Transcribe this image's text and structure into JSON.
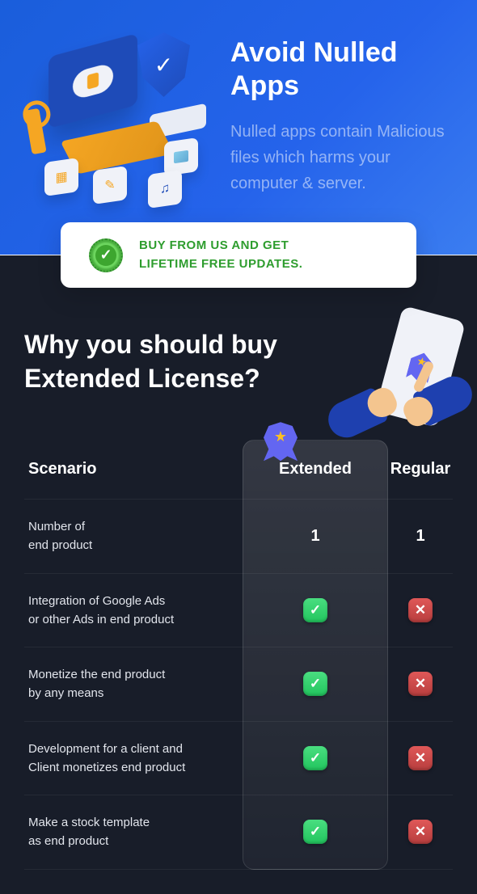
{
  "hero": {
    "title": "Avoid Nulled Apps",
    "description": "Nulled apps contain Malicious files which harms your computer & server."
  },
  "cta": {
    "line1": "BUY FROM US AND GET",
    "line2": "LIFETIME FREE UPDATES."
  },
  "section": {
    "title": "Why you should buy Extended License?"
  },
  "table": {
    "headers": {
      "scenario": "Scenario",
      "extended": "Extended",
      "regular": "Regular"
    },
    "rows": [
      {
        "scenario": "Number of\nend product",
        "extended_type": "text",
        "extended": "1",
        "regular_type": "text",
        "regular": "1"
      },
      {
        "scenario": "Integration of Google Ads\nor other Ads in end product",
        "extended_type": "check",
        "regular_type": "cross"
      },
      {
        "scenario": "Monetize the end product\nby any means",
        "extended_type": "check",
        "regular_type": "cross"
      },
      {
        "scenario": "Development for a client and\nClient monetizes end product",
        "extended_type": "check",
        "regular_type": "cross"
      },
      {
        "scenario": "Make a stock template\nas end product",
        "extended_type": "check",
        "regular_type": "cross"
      }
    ]
  }
}
